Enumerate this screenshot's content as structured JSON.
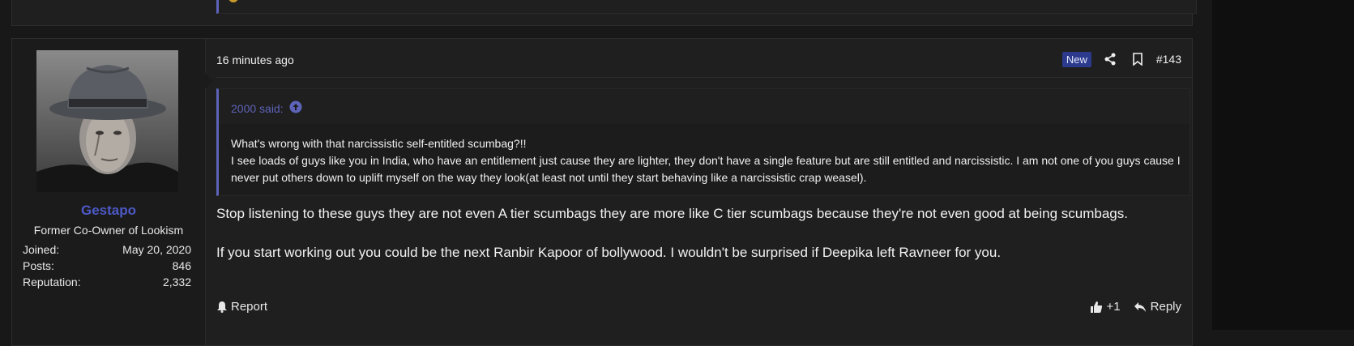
{
  "post": {
    "user": {
      "name": "Gestapo",
      "title": "Former Co-Owner of Lookism",
      "stats": [
        {
          "label": "Joined:",
          "value": "May 20, 2020"
        },
        {
          "label": "Posts:",
          "value": "846"
        },
        {
          "label": "Reputation:",
          "value": "2,332"
        }
      ]
    },
    "time": "16 minutes ago",
    "badge_new": "New",
    "post_number": "#143",
    "quote": {
      "author": "2000 said:",
      "lines": [
        "What's wrong with that narcissistic self-entitled scumbag?!!",
        "I see loads of guys like you in India, who have an entitlement just cause they are lighter, they don't have a single feature but are still entitled and narcissistic. I am not one of you guys cause I never put others down to uplift myself on the way they look(at least not until they start behaving like a narcissistic crap weasel)."
      ]
    },
    "body": [
      "Stop listening to these guys they are not even A tier scumbags they are more like C tier scumbags because they're not even good at being scumbags.",
      "If you start working out you could be the next Ranbir Kapoor of bollywood. I wouldn't be surprised if Deepika left Ravneer for you."
    ],
    "footer": {
      "report_label": "Report",
      "like_label": "+1",
      "reply_label": "Reply"
    }
  },
  "colors": {
    "accent": "#4d59c7",
    "quote_border": "#5d63b8",
    "badge_bg": "#2b3a8c",
    "page_bg": "#181818",
    "post_bg": "#1f1f1f"
  }
}
